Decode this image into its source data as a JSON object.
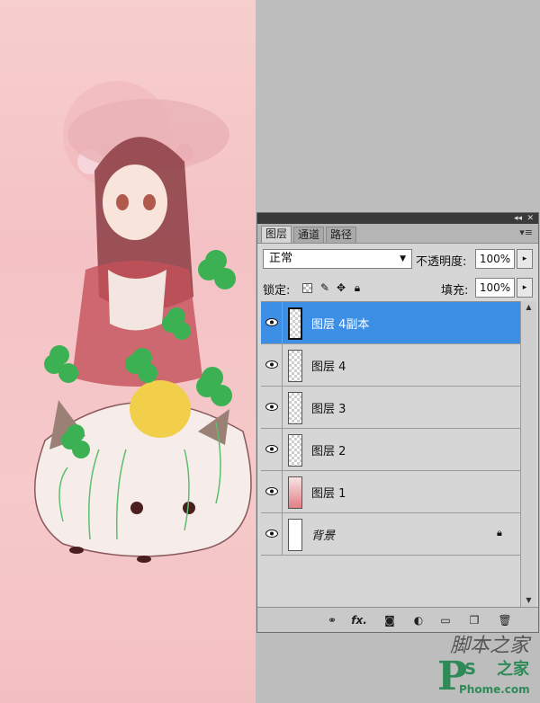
{
  "panel": {
    "tabs": [
      {
        "label": "图层",
        "active": true
      },
      {
        "label": "通道",
        "active": false
      },
      {
        "label": "路径",
        "active": false
      }
    ],
    "blend_mode": "正常",
    "opacity_label": "不透明度:",
    "opacity_value": "100%",
    "lock_label": "锁定:",
    "fill_label": "填充:",
    "fill_value": "100%",
    "layers": [
      {
        "name": "图层 4副本",
        "selected": true,
        "thumb": "checker",
        "visible": true
      },
      {
        "name": "图层 4",
        "selected": false,
        "thumb": "checker",
        "visible": true
      },
      {
        "name": "图层 3",
        "selected": false,
        "thumb": "checker",
        "visible": true
      },
      {
        "name": "图层 2",
        "selected": false,
        "thumb": "checker",
        "visible": true
      },
      {
        "name": "图层 1",
        "selected": false,
        "thumb": "pink",
        "visible": true
      },
      {
        "name": "背景",
        "selected": false,
        "thumb": "white",
        "visible": true,
        "locked": true
      }
    ],
    "bottom_tools": [
      "link-icon",
      "fx-icon",
      "mask-icon",
      "adjustment-icon",
      "group-icon",
      "new-layer-icon",
      "trash-icon"
    ],
    "fx_label": "fx."
  },
  "watermark": {
    "line1": "脚本之家",
    "logo_p": "P",
    "logo_s": "S",
    "logo_zhi": "之家",
    "site": "Phome.com"
  },
  "colors": {
    "selection": "#3d8fe6",
    "canvas_pink": "#f4c2c4",
    "panel_bg": "#d6d6d6",
    "workspace_grey": "#bdbdbd"
  }
}
